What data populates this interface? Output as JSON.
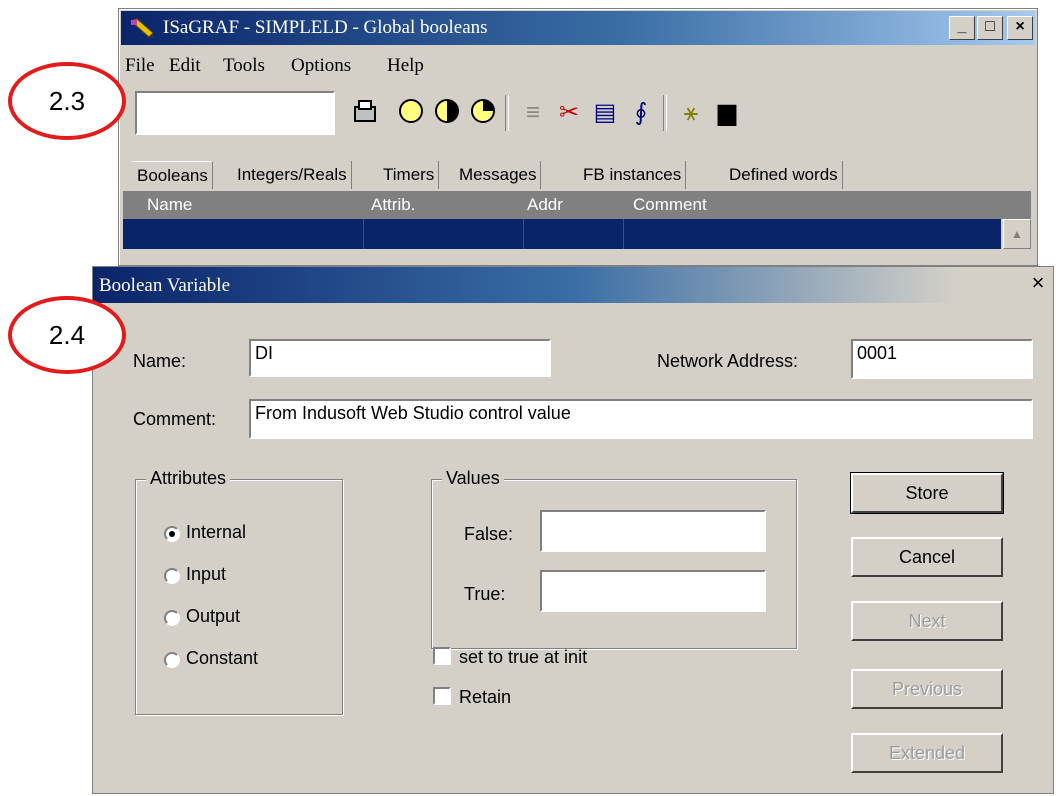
{
  "top_window": {
    "title": "ISaGRAF - SIMPLELD - Global booleans",
    "caption_buttons": [
      "_",
      "□",
      "×"
    ],
    "menu": [
      "File",
      "Edit",
      "Tools",
      "Options",
      "Help"
    ],
    "toolbar_input_value": "",
    "toolbar_icons": [
      "open-icon",
      "circle-empty-icon",
      "circle-half-icon",
      "circle-quarter-icon",
      "list-icon",
      "cut-icon",
      "copy-icon",
      "brush-icon",
      "wand-icon",
      "print-icon"
    ],
    "tabs": [
      "Booleans",
      "Integers/Reals",
      "Timers",
      "Messages",
      "FB instances",
      "Defined words"
    ],
    "active_tab": "Booleans",
    "columns": [
      "Name",
      "Attrib.",
      "Addr",
      "Comment"
    ]
  },
  "dialog": {
    "title": "Boolean Variable",
    "name_label": "Name:",
    "name_value": "DI",
    "network_address_label": "Network Address:",
    "network_address_value": "0001",
    "comment_label": "Comment:",
    "comment_value": "From Indusoft Web Studio control value",
    "attributes": {
      "legend": "Attributes",
      "options": [
        "Internal",
        "Input",
        "Output",
        "Constant"
      ],
      "selected": "Internal"
    },
    "values": {
      "legend": "Values",
      "false_label": "False:",
      "false_value": "",
      "true_label": "True:",
      "true_value": ""
    },
    "checkboxes": [
      {
        "label": "set to true at init",
        "checked": false
      },
      {
        "label": "Retain",
        "checked": false
      }
    ],
    "buttons": [
      {
        "label": "Store",
        "enabled": true
      },
      {
        "label": "Cancel",
        "enabled": true
      },
      {
        "label": "Next",
        "enabled": false
      },
      {
        "label": "Previous",
        "enabled": false
      },
      {
        "label": "Extended",
        "enabled": false
      }
    ]
  },
  "callouts": [
    "2.3",
    "2.4"
  ],
  "colors": {
    "titlebar": "#0a246a",
    "selection": "#0a246a",
    "callout_border": "#e41b1b",
    "face": "#d4d0c8"
  }
}
